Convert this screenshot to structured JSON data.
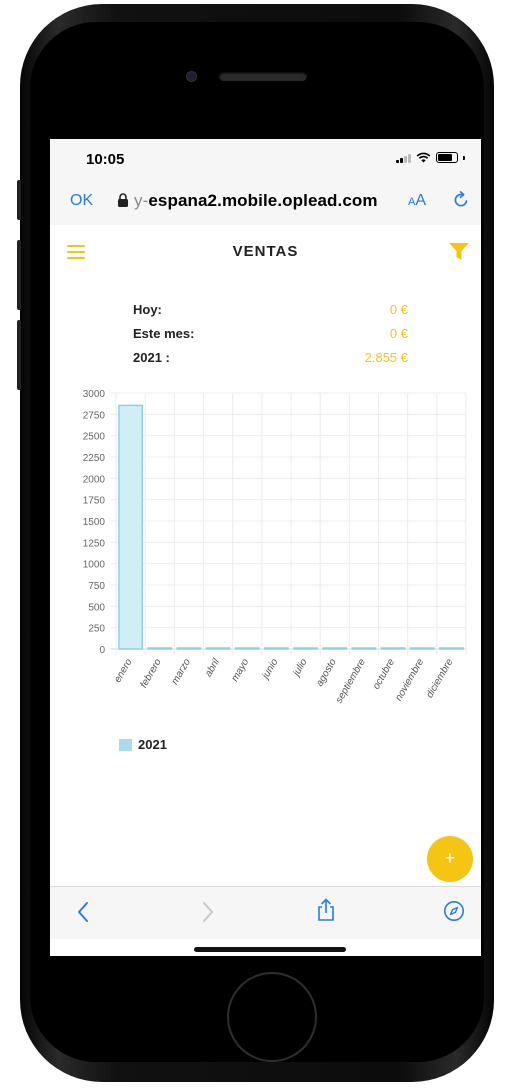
{
  "status_bar": {
    "time": "10:05"
  },
  "url_bar": {
    "ok_label": "OK",
    "url_prefix": "y-",
    "url_domain": "espana2.mobile.oplead.com",
    "aa_small": "A",
    "aa_large": "A"
  },
  "app_header": {
    "title": "VENTAS"
  },
  "stats": [
    {
      "label": "Hoy:",
      "value": "0 €"
    },
    {
      "label": "Este mes:",
      "value": "0 €"
    },
    {
      "label": "2021 :",
      "value": "2.855 €"
    }
  ],
  "fab": {
    "label": "+"
  },
  "icons": {
    "menu": "hamburger-menu-icon",
    "filter": "filter-funnel-icon",
    "lock": "lock-icon",
    "reload": "reload-icon",
    "back": "chevron-left-icon",
    "forward": "chevron-right-icon",
    "share": "share-icon",
    "compass": "compass-icon"
  },
  "colors": {
    "accent": "#f4c513",
    "link": "#2a7ce6",
    "bar_fill": "#cfeef6",
    "bar_stroke": "#8fd0e4",
    "legend": "#a6dcec"
  },
  "chart_data": {
    "type": "bar",
    "categories": [
      "enero",
      "febrero",
      "marzo",
      "abril",
      "mayo",
      "junio",
      "julio",
      "agosto",
      "septiembre",
      "octubre",
      "noviembre",
      "diciembre"
    ],
    "series": [
      {
        "name": "2021",
        "values": [
          2855,
          0,
          0,
          0,
          0,
          0,
          0,
          0,
          0,
          0,
          0,
          0
        ]
      }
    ],
    "ylim": [
      0,
      3000
    ],
    "yticks": [
      0,
      250,
      500,
      750,
      1000,
      1250,
      1500,
      1750,
      2000,
      2250,
      2500,
      2750,
      3000
    ],
    "grid": true,
    "legend_position": "bottom-left"
  }
}
